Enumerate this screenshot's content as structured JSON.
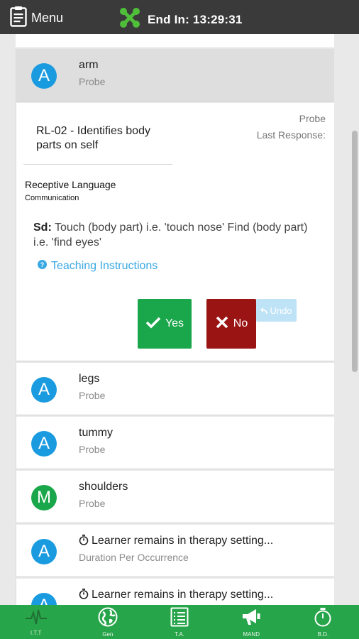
{
  "topbar": {
    "menu_label": "Menu",
    "timer_label": "End In: 13:29:31"
  },
  "colors": {
    "topbar": "#3a3a3a",
    "accent_blue": "#1a9be0",
    "badge_green": "#1aa64a",
    "yes_green": "#1aa64a",
    "no_red": "#9a1414",
    "nav_green": "#27a54a",
    "link_blue": "#3aa8e3"
  },
  "selected_item": {
    "badge": "A",
    "title": "arm",
    "subtitle": "Probe"
  },
  "detail": {
    "target": "RL-02 - Identifies body parts on self",
    "probe_label": "Probe",
    "last_response_label": "Last Response:",
    "domain": "Receptive Language",
    "subdomain": "Communication",
    "sd_label": "Sd:",
    "sd_text": "Touch (body part) i.e. 'touch nose' Find (body part) i.e. 'find eyes'",
    "teaching_link": "Teaching Instructions",
    "yes_label": "Yes",
    "no_label": "No",
    "undo_label": "Undo"
  },
  "list_items": [
    {
      "badge": "A",
      "badge_color": "blue",
      "title": "legs",
      "subtitle": "Probe",
      "icon": ""
    },
    {
      "badge": "A",
      "badge_color": "blue",
      "title": "tummy",
      "subtitle": "Probe",
      "icon": ""
    },
    {
      "badge": "M",
      "badge_color": "green",
      "title": "shoulders",
      "subtitle": "Probe",
      "icon": ""
    },
    {
      "badge": "A",
      "badge_color": "blue",
      "title": "Learner remains in therapy setting...",
      "subtitle": "Duration Per Occurrence",
      "icon": "stopwatch-icon"
    },
    {
      "badge": "A",
      "badge_color": "blue",
      "title": "Learner remains in therapy setting...",
      "subtitle": "",
      "icon": "stopwatch-icon"
    }
  ],
  "bottom_nav": [
    {
      "label": "I.T.T",
      "icon": "heartbeat-icon",
      "active": true
    },
    {
      "label": "Gen",
      "icon": "globe-icon",
      "active": false
    },
    {
      "label": "T.A.",
      "icon": "list-icon",
      "active": false
    },
    {
      "label": "MAND",
      "icon": "megaphone-icon",
      "active": false
    },
    {
      "label": "B.D.",
      "icon": "stopwatch-icon",
      "active": false
    }
  ]
}
